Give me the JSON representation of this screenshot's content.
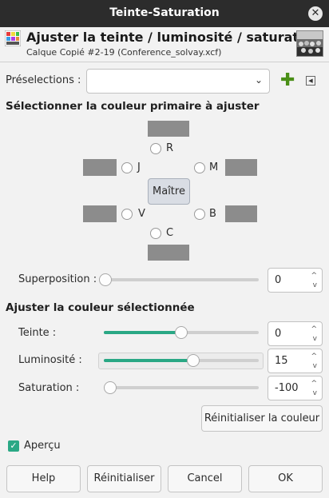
{
  "window": {
    "title": "Teinte-Saturation",
    "close_glyph": "✕"
  },
  "header": {
    "heading": "Ajuster la teinte / luminosité / saturation",
    "subheading": "Calque Copié #2-19 (Conference_solvay.xcf)"
  },
  "presets": {
    "label": "Préselections :",
    "value": "",
    "chevron": "⌄",
    "add_glyph": "✚",
    "menu_glyph": "◀"
  },
  "primary": {
    "title": "Sélectionner la couleur primaire à ajuster",
    "labels": {
      "r": "R",
      "j": "J",
      "m": "M",
      "v": "V",
      "b": "B",
      "c": "C"
    },
    "master_label": "Maître"
  },
  "overlap": {
    "label": "Superposition :",
    "value": "0",
    "fraction": 0.0
  },
  "adjust": {
    "title": "Ajuster la couleur sélectionnée",
    "hue": {
      "label": "Teinte :",
      "value": "0",
      "fraction": 0.5
    },
    "lightness": {
      "label": "Luminosité :",
      "value": "15",
      "fraction": 0.575
    },
    "saturation": {
      "label": "Saturation :",
      "value": "-100",
      "fraction": 0.0
    },
    "reset_color_label": "Réinitialiser la couleur"
  },
  "preview": {
    "label": "Aperçu",
    "checked": true,
    "check_glyph": "✓"
  },
  "buttons": {
    "help": "Help",
    "reset": "Réinitialiser",
    "cancel": "Cancel",
    "ok": "OK"
  },
  "spin_glyphs": {
    "up": "^",
    "down": "v"
  },
  "colors": {
    "accent": "#2aa885",
    "swatch": "#8c8c8c",
    "titlebar": "#2c2c2c",
    "add_icon": "#4a8f17"
  }
}
